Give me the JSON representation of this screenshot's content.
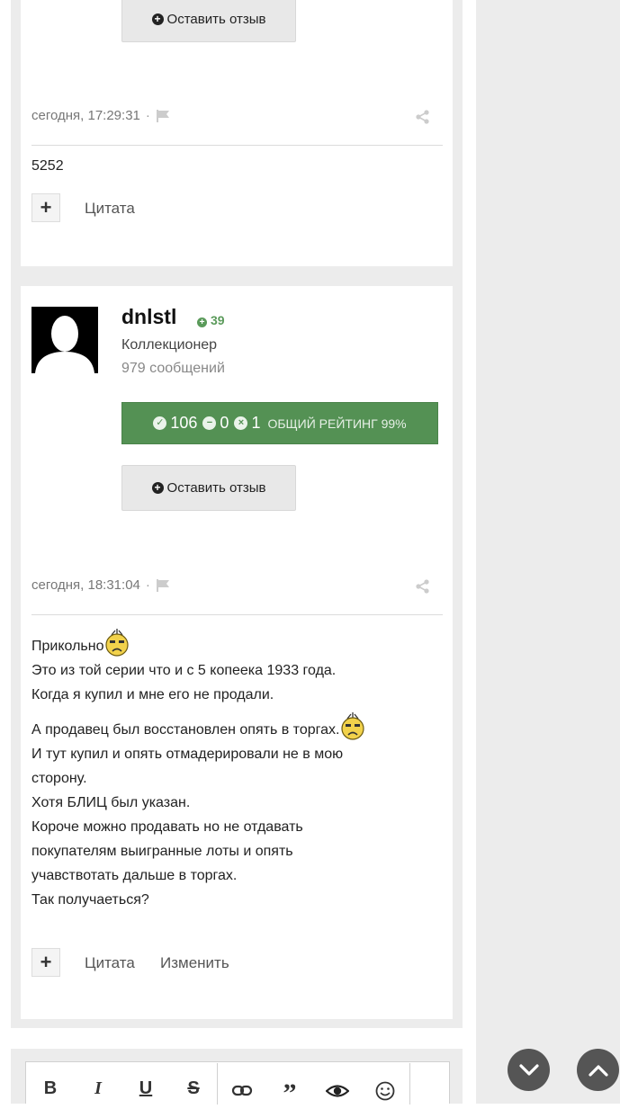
{
  "top_card": {
    "review_button_label": "Оставить отзыв",
    "timestamp": "сегодня, 17:29:31",
    "separator": "·",
    "post_text": "5252",
    "rep_plus": "+",
    "quote_label": "Цитата"
  },
  "post": {
    "username": "dnlstl",
    "reputation": "39",
    "rank": "Коллекционер",
    "post_count": "979 сообщений",
    "rating": {
      "positive": "106",
      "neutral": "0",
      "negative": "1",
      "caption": "ОБЩИЙ РЕЙТИНГ 99%",
      "color": "#549154"
    },
    "review_button_label": "Оставить отзыв",
    "timestamp": "сегодня, 18:31:04",
    "separator": "·",
    "body": {
      "line1": "Прикольно",
      "line2": "Это из той серии что и с 5 копеека 1933 года.",
      "line3": "Когда я купил и мне его не продали.",
      "line4": "А продавец был восстановлен опять в торгах.",
      "line5": "И тут купил и опять отмадерировали не в мою сторону.",
      "line6": "Хотя БЛИЦ был указан.",
      "line7": "Короче можно продавать но не отдавать покупателям выигранные лоты и опять учавствотать дальше в торгах.",
      "line8": "Так получаеться?"
    },
    "rep_plus": "+",
    "quote_label": "Цитата",
    "edit_label": "Изменить"
  },
  "editor": {
    "tools": [
      "bold-icon",
      "italic-icon",
      "underline-icon",
      "strikethrough-icon",
      "link-icon",
      "quote-icon",
      "spoiler-eye-icon",
      "smiley-icon"
    ]
  },
  "scroll": {
    "down_icon": "chevron-down-icon",
    "up_icon": "chevron-up-icon"
  }
}
